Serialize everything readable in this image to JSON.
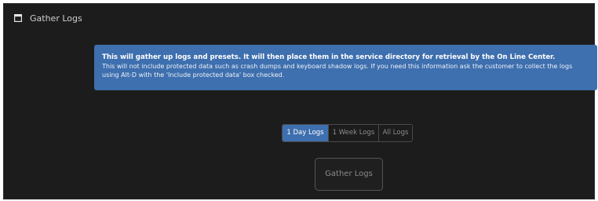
{
  "header": {
    "title": "Gather Logs",
    "icon": "window-icon"
  },
  "info": {
    "title": "This will gather up logs and presets. It will then place them in the service directory for retrieval by the On Line Center.",
    "body": "This will not include protected data such as crash dumps and keyboard shadow logs. If you need this information ask the customer to collect the logs using Alt-D with the 'Include protected data' box checked.",
    "background_color": "#3e6fae"
  },
  "range_selector": {
    "options": [
      {
        "label": "1 Day Logs",
        "selected": true
      },
      {
        "label": "1 Week Logs",
        "selected": false
      },
      {
        "label": "All Logs",
        "selected": false
      }
    ]
  },
  "actions": {
    "gather_label": "Gather Logs"
  },
  "colors": {
    "panel_background": "#1c1c1c",
    "accent": "#3e6fae"
  }
}
